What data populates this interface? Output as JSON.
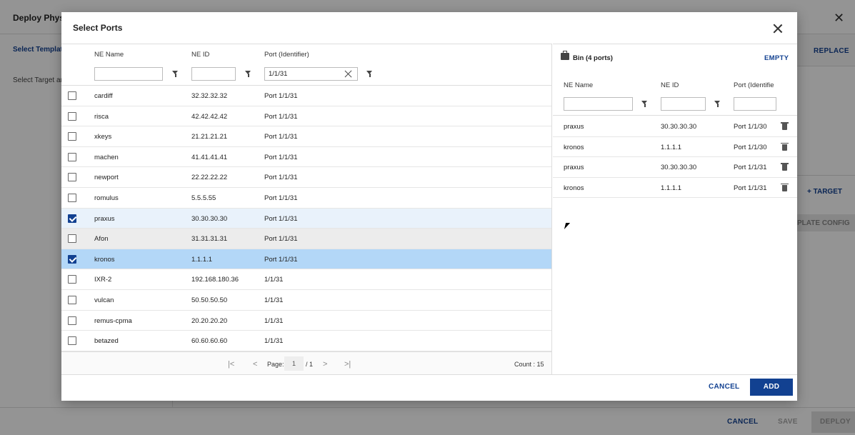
{
  "background": {
    "title": "Deploy Physic",
    "select_template": "Select Template",
    "select_target": "Select Target an",
    "replace": "REPLACE",
    "target": "+ TARGET",
    "template_config": "PLATE CONFIG",
    "footer": {
      "cancel": "CANCEL",
      "save": "SAVE",
      "deploy": "DEPLOY"
    }
  },
  "dialog": {
    "title": "Select Ports",
    "left_table": {
      "headers": {
        "ne_name": "NE Name",
        "ne_id": "NE ID",
        "port": "Port (Identifier)"
      },
      "filters": {
        "ne_name": "",
        "ne_id": "",
        "port": "1/1/31"
      },
      "rows": [
        {
          "name": "cardiff",
          "id": "32.32.32.32",
          "port": "Port 1/1/31"
        },
        {
          "name": "risca",
          "id": "42.42.42.42",
          "port": "Port 1/1/31"
        },
        {
          "name": "xkeys",
          "id": "21.21.21.21",
          "port": "Port 1/1/31"
        },
        {
          "name": "machen",
          "id": "41.41.41.41",
          "port": "Port 1/1/31"
        },
        {
          "name": "newport",
          "id": "22.22.22.22",
          "port": "Port 1/1/31"
        },
        {
          "name": "romulus",
          "id": "5.5.5.55",
          "port": "Port 1/1/31"
        },
        {
          "name": "praxus",
          "id": "30.30.30.30",
          "port": "Port 1/1/31"
        },
        {
          "name": "Afon",
          "id": "31.31.31.31",
          "port": "Port 1/1/31"
        },
        {
          "name": "kronos",
          "id": "1.1.1.1",
          "port": "Port 1/1/31"
        },
        {
          "name": "IXR-2",
          "id": "192.168.180.36",
          "port": "1/1/31"
        },
        {
          "name": "vulcan",
          "id": "50.50.50.50",
          "port": "1/1/31"
        },
        {
          "name": "remus-cpma",
          "id": "20.20.20.20",
          "port": "1/1/31"
        },
        {
          "name": "betazed",
          "id": "60.60.60.60",
          "port": "1/1/31"
        }
      ],
      "pager": {
        "page_label": "Page:",
        "page": "1",
        "total": "/ 1",
        "count": "Count : 15"
      }
    },
    "bin": {
      "title": "Bin (4 ports)",
      "empty": "EMPTY",
      "headers": {
        "ne_name": "NE Name",
        "ne_id": "NE ID",
        "port": "Port (Identifie"
      },
      "rows": [
        {
          "name": "praxus",
          "id": "30.30.30.30",
          "port": "Port 1/1/30"
        },
        {
          "name": "kronos",
          "id": "1.1.1.1",
          "port": "Port 1/1/30"
        },
        {
          "name": "praxus",
          "id": "30.30.30.30",
          "port": "Port 1/1/31"
        },
        {
          "name": "kronos",
          "id": "1.1.1.1",
          "port": "Port 1/1/31"
        }
      ]
    },
    "footer": {
      "cancel": "CANCEL",
      "add": "ADD"
    }
  },
  "colors": {
    "accent": "#124191",
    "selected_row": "#b3d7f7",
    "checked_row": "#e9f2fb"
  }
}
